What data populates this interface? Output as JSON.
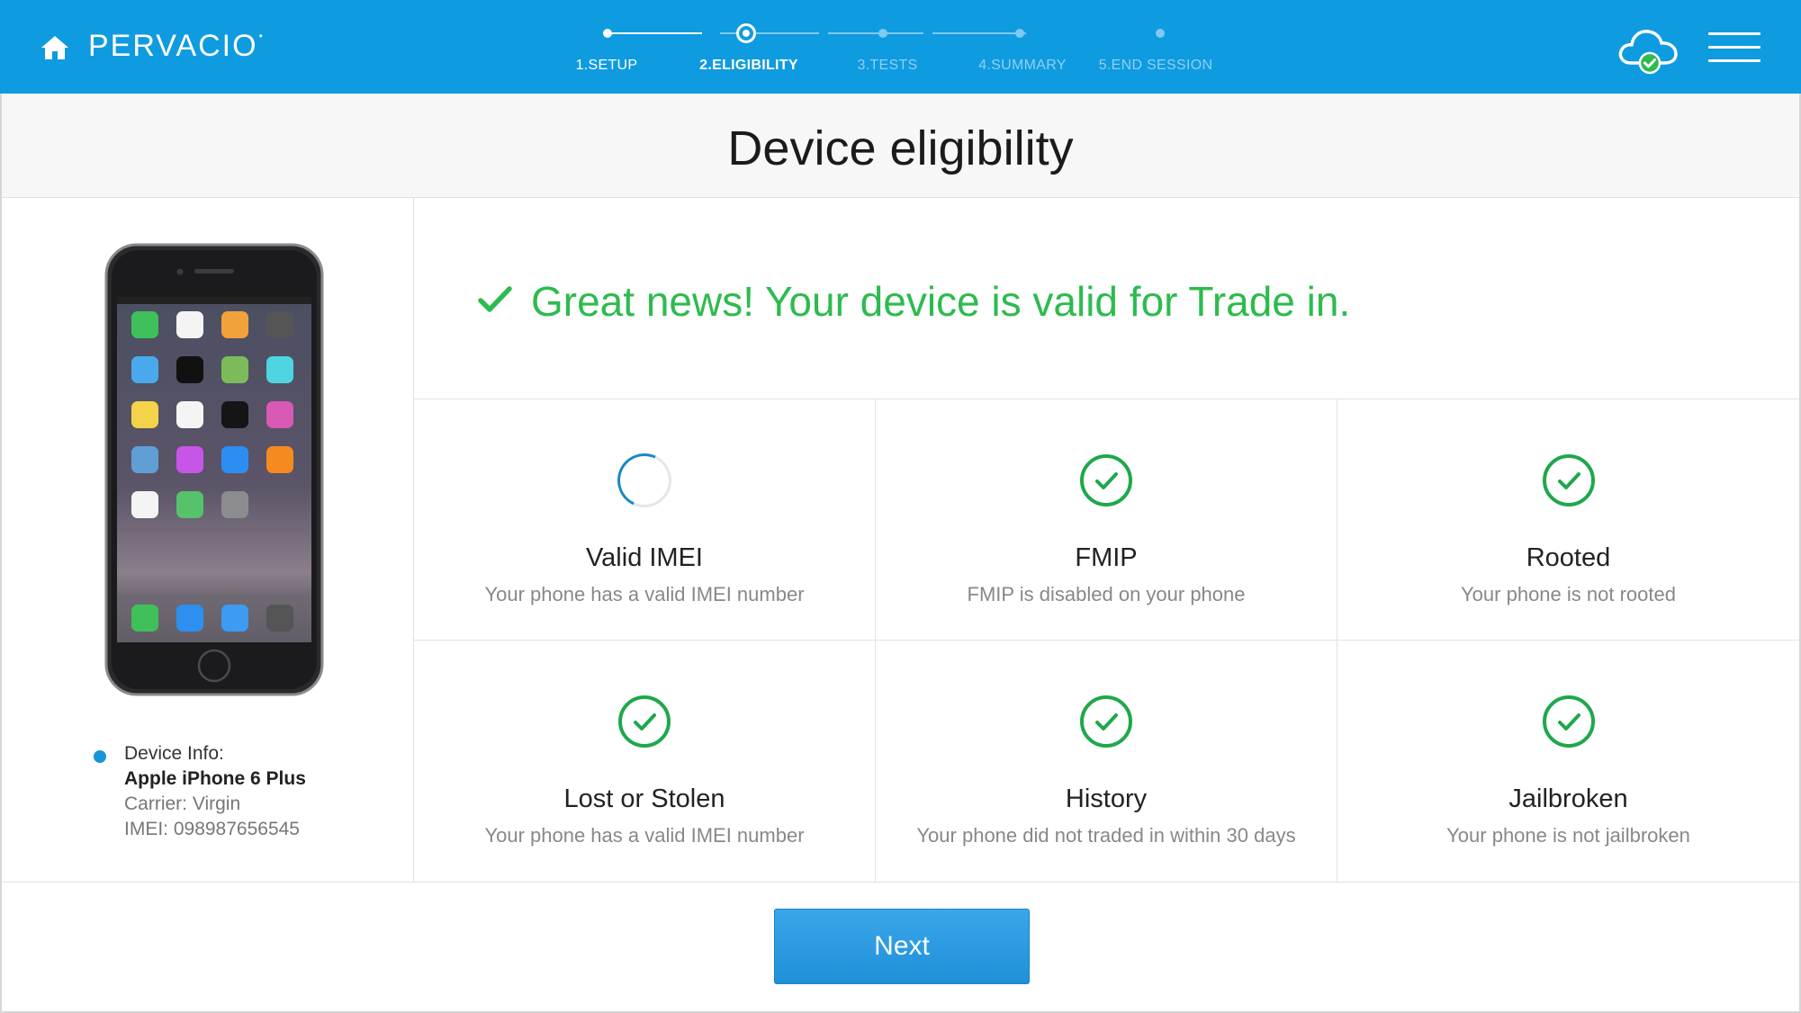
{
  "header": {
    "brand": "PERVACIO",
    "brand_mark": "•",
    "steps": [
      {
        "label": "1.SETUP",
        "state": "done"
      },
      {
        "label": "2.ELIGIBILITY",
        "state": "current"
      },
      {
        "label": "3.TESTS",
        "state": "pending"
      },
      {
        "label": "4.SUMMARY",
        "state": "pending"
      },
      {
        "label": "5.END SESSION",
        "state": "pending"
      }
    ],
    "icons": {
      "home": "home-icon",
      "cloud": "cloud-check-icon",
      "menu": "hamburger-menu-icon"
    }
  },
  "page": {
    "title": "Device eligibility"
  },
  "device": {
    "info_label": "Device Info:",
    "model": "Apple iPhone 6 Plus",
    "carrier": "Carrier: Virgin",
    "imei": "IMEI: 098987656545"
  },
  "result": {
    "message": "Great news! Your device is valid for Trade in."
  },
  "checks": [
    {
      "title": "Valid IMEI",
      "desc": "Your phone has a valid IMEI number",
      "status": "loading"
    },
    {
      "title": "FMIP",
      "desc": "FMIP is disabled on your phone",
      "status": "passed"
    },
    {
      "title": "Rooted",
      "desc": "Your phone is not rooted",
      "status": "passed"
    },
    {
      "title": "Lost or Stolen",
      "desc": "Your phone has a valid IMEI number",
      "status": "passed"
    },
    {
      "title": "History",
      "desc": "Your phone did not traded in within 30 days",
      "status": "passed"
    },
    {
      "title": "Jailbroken",
      "desc": "Your phone is not jailbroken",
      "status": "passed"
    }
  ],
  "footer": {
    "next_label": "Next"
  },
  "colors": {
    "header": "#0f9be0",
    "success": "#2dbb4e",
    "check_ring": "#1fa84b",
    "button": "#2796dc"
  }
}
